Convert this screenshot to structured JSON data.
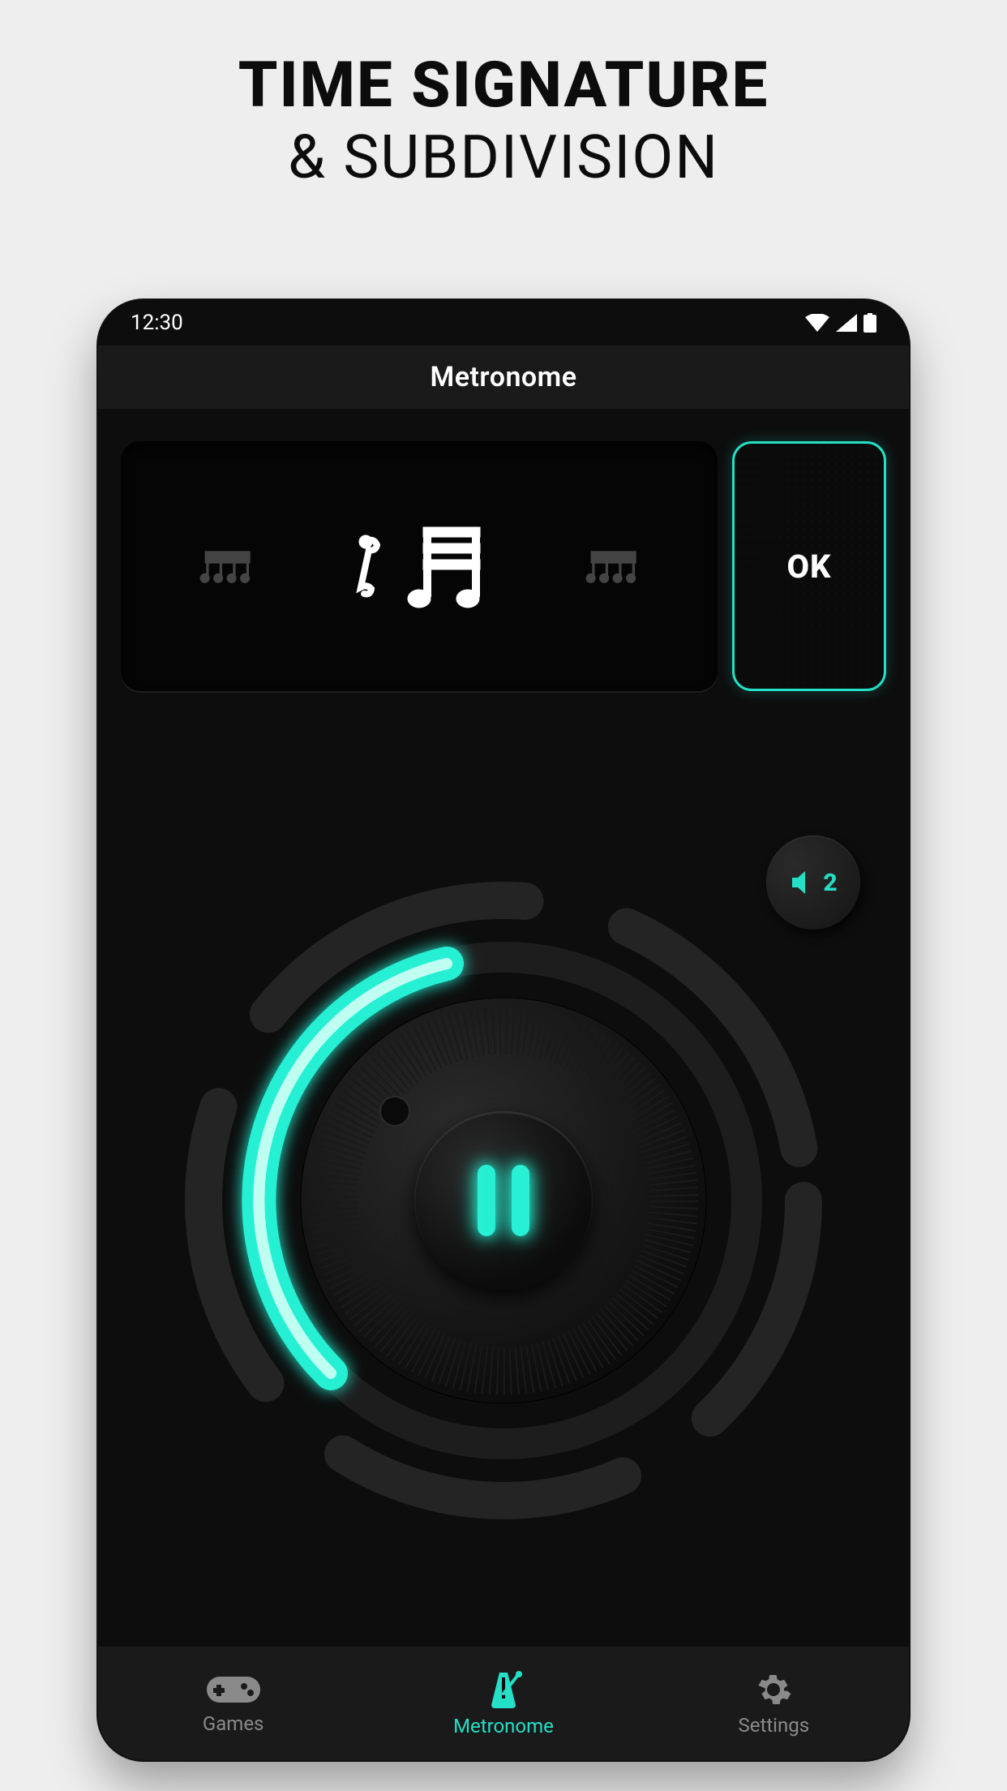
{
  "marketing": {
    "line1": "TIME SIGNATURE",
    "line2": "& SUBDIVISION"
  },
  "statusbar": {
    "time": "12:30"
  },
  "header": {
    "title": "Metronome"
  },
  "picker": {
    "ok_label": "OK",
    "options": {
      "left": "sixteenth-group-icon",
      "center": "swing-sixteenth-icon",
      "right": "sixteenth-group-icon"
    }
  },
  "volume": {
    "level": "2"
  },
  "dial": {
    "state": "playing"
  },
  "nav": {
    "items": [
      {
        "id": "games",
        "label": "Games",
        "active": false
      },
      {
        "id": "metronome",
        "label": "Metronome",
        "active": true
      },
      {
        "id": "settings",
        "label": "Settings",
        "active": false
      }
    ]
  },
  "colors": {
    "accent": "#23e0c6",
    "bg": "#0d0d0d",
    "frame": "#eeeeee"
  }
}
